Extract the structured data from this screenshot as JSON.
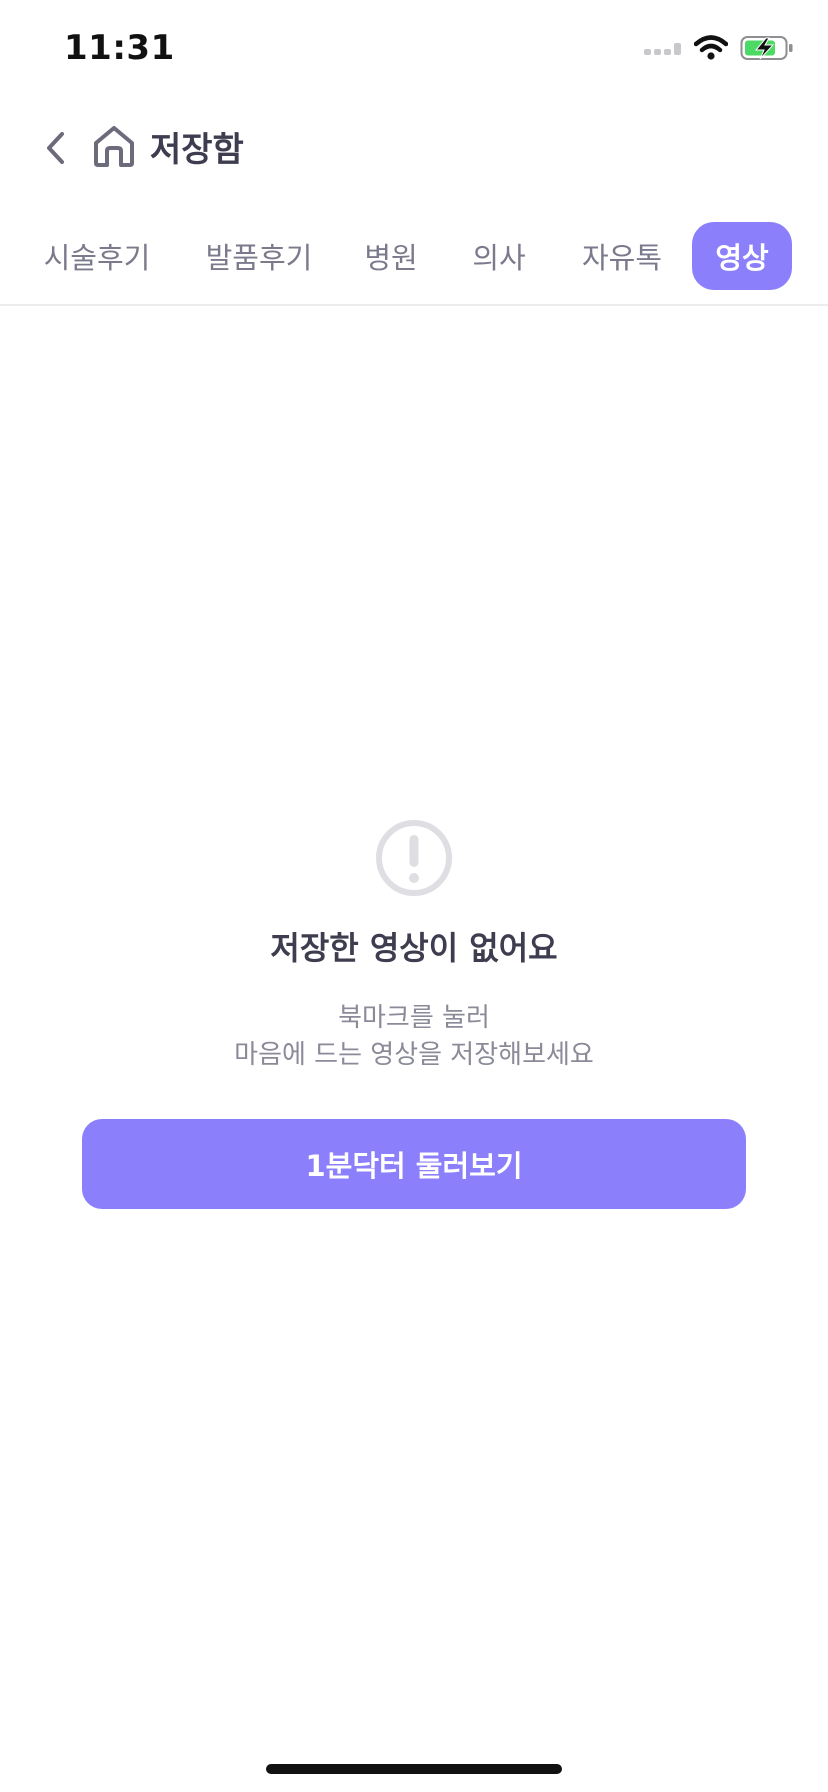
{
  "status_bar": {
    "time": "11:31",
    "icons": [
      "cellular-signal-icon",
      "wifi-icon",
      "battery-charging-icon"
    ]
  },
  "header": {
    "back_icon": "chevron-left-icon",
    "home_icon": "home-icon",
    "title": "저장함"
  },
  "tabs": [
    {
      "label": "시술후기",
      "active": false
    },
    {
      "label": "발품후기",
      "active": false
    },
    {
      "label": "병원",
      "active": false
    },
    {
      "label": "의사",
      "active": false
    },
    {
      "label": "자유톡",
      "active": false
    },
    {
      "label": "영상",
      "active": true
    }
  ],
  "empty_state": {
    "icon": "exclamation-circle-icon",
    "title": "저장한 영상이 없어요",
    "desc_line1": "북마크를 눌러",
    "desc_line2": "마음에 드는 영상을 저장해보세요",
    "button_label": "1분닥터 둘러보기"
  },
  "colors": {
    "accent": "#8b7ffc",
    "title_text": "#3d3d4f",
    "muted_text": "#7a7a8c",
    "battery_green": "#4cd964"
  }
}
